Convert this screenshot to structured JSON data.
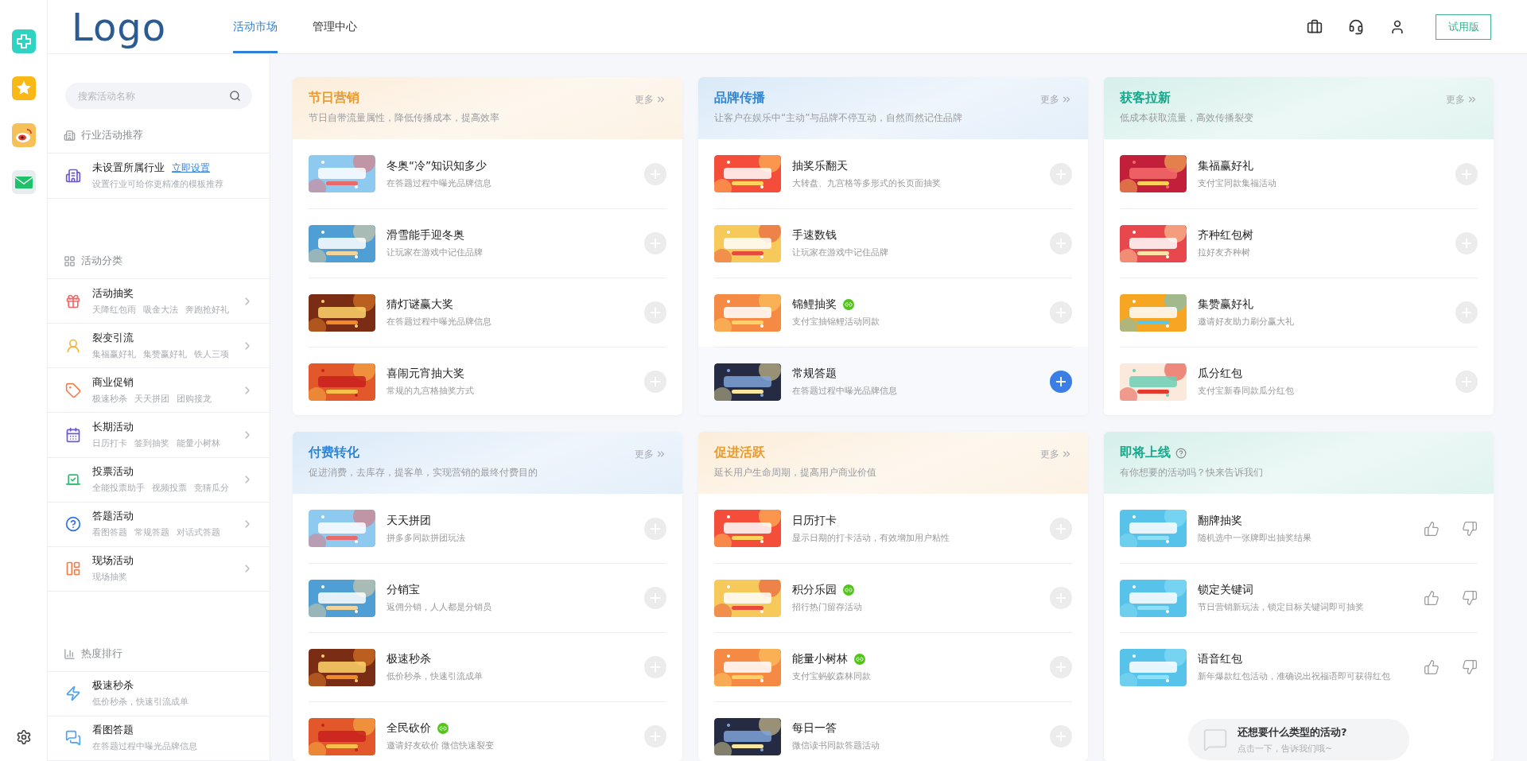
{
  "topbar": {
    "logo": "Logo",
    "tabs": [
      {
        "label": "活动市场",
        "selected": true
      },
      {
        "label": "管理中心",
        "selected": false
      }
    ],
    "trial_button": "试用版"
  },
  "sidebar": {
    "search": {
      "placeholder": "搜索活动名称"
    },
    "industry": {
      "title": "行业活动推荐",
      "name": "未设置所属行业",
      "link": "立即设置",
      "desc": "设置行业可给你更精准的模板推荐"
    },
    "categories": {
      "title": "活动分类",
      "items": [
        {
          "name": "活动抽奖",
          "tags": [
            "天降红包雨",
            "吸金大法",
            "奔跑抢好礼"
          ],
          "color": "#f2676a"
        },
        {
          "name": "裂变引流",
          "tags": [
            "集福赢好礼",
            "集赞赢好礼",
            "铁人三项"
          ],
          "color": "#f7b23b"
        },
        {
          "name": "商业促销",
          "tags": [
            "极速秒杀",
            "天天拼团",
            "团购接龙"
          ],
          "color": "#f47c4a"
        },
        {
          "name": "长期活动",
          "tags": [
            "日历打卡",
            "签到抽奖",
            "能量小树林"
          ],
          "color": "#6a5acd"
        },
        {
          "name": "投票活动",
          "tags": [
            "全能投票助手",
            "视频投票",
            "竞猜瓜分"
          ],
          "color": "#2fbf71"
        },
        {
          "name": "答题活动",
          "tags": [
            "看图答题",
            "常规答题",
            "对话式答题"
          ],
          "color": "#2f6fe4"
        },
        {
          "name": "现场活动",
          "tags": [
            "现场抽奖"
          ],
          "color": "#f47c4a"
        }
      ]
    },
    "ranking": {
      "title": "热度排行",
      "items": [
        {
          "name": "极速秒杀",
          "desc": "低价秒杀，快速引流成单"
        },
        {
          "name": "看图答题",
          "desc": "在答题过程中曝光品牌信息"
        }
      ]
    }
  },
  "cards": [
    {
      "title": "节日营销",
      "subtitle": "节日自带流量属性，降低传播成本，提高效率",
      "color": "#eb9a2c",
      "more": "更多",
      "items": [
        {
          "kind": "add",
          "title": "冬奥“冷”知识知多少",
          "desc": "在答题过程中曝光品牌信息",
          "badge": false,
          "selected": false
        },
        {
          "kind": "add",
          "title": "滑雪能手迎冬奥",
          "desc": "让玩家在游戏中记住品牌",
          "badge": false,
          "selected": false
        },
        {
          "kind": "add",
          "title": "猜灯谜赢大奖",
          "desc": "在答题过程中曝光品牌信息",
          "badge": false,
          "selected": false
        },
        {
          "kind": "add",
          "title": "喜闹元宵抽大奖",
          "desc": "常规的九宫格抽奖方式",
          "badge": false,
          "selected": false
        }
      ]
    },
    {
      "title": "品牌传播",
      "subtitle": "让客户在娱乐中“主动”与品牌不停互动，自然而然记住品牌",
      "color": "#2f86d8",
      "more": "更多",
      "items": [
        {
          "kind": "add",
          "title": "抽奖乐翻天",
          "desc": "大转盘、九宫格等多形式的长页面抽奖",
          "badge": false,
          "selected": false
        },
        {
          "kind": "add",
          "title": "手速数钱",
          "desc": "让玩家在游戏中记住品牌",
          "badge": false,
          "selected": false
        },
        {
          "kind": "add",
          "title": "锦鲤抽奖",
          "desc": "支付宝抽锦鲤活动同款",
          "badge": true,
          "selected": false
        },
        {
          "kind": "add",
          "title": "常规答题",
          "desc": "在答题过程中曝光品牌信息",
          "badge": false,
          "selected": true
        }
      ]
    },
    {
      "title": "获客拉新",
      "subtitle": "低成本获取流量，高效传播裂变",
      "color": "#17a88b",
      "more": "更多",
      "items": [
        {
          "kind": "add",
          "title": "集福赢好礼",
          "desc": "支付宝同款集福活动",
          "badge": false,
          "selected": false
        },
        {
          "kind": "add",
          "title": "齐种红包树",
          "desc": "拉好友齐种树",
          "badge": false,
          "selected": false
        },
        {
          "kind": "add",
          "title": "集赞赢好礼",
          "desc": "邀请好友助力刷分赢大礼",
          "badge": false,
          "selected": false
        },
        {
          "kind": "add",
          "title": "瓜分红包",
          "desc": "支付宝新春同款瓜分红包",
          "badge": false,
          "selected": false
        }
      ]
    },
    {
      "title": "付费转化",
      "subtitle": "促进消费，去库存，提客单，实现营销的最终付费目的",
      "color": "#2f86d8",
      "more": "更多",
      "items": [
        {
          "kind": "add",
          "title": "天天拼团",
          "desc": "拼多多同款拼团玩法",
          "badge": false,
          "selected": false
        },
        {
          "kind": "add",
          "title": "分销宝",
          "desc": "返佣分销，人人都是分销员",
          "badge": false,
          "selected": false
        },
        {
          "kind": "add",
          "title": "极速秒杀",
          "desc": "低价秒杀，快速引流成单",
          "badge": false,
          "selected": false
        },
        {
          "kind": "add",
          "title": "全民砍价",
          "desc": "邀请好友砍价 微信快速裂变",
          "badge": true,
          "selected": false
        }
      ]
    },
    {
      "title": "促进活跃",
      "subtitle": "延长用户生命周期，提高用户商业价值",
      "color": "#eb9a2c",
      "more": "更多",
      "items": [
        {
          "kind": "add",
          "title": "日历打卡",
          "desc": "显示日期的打卡活动，有效增加用户粘性",
          "badge": false,
          "selected": false
        },
        {
          "kind": "add",
          "title": "积分乐园",
          "desc": "招行热门留存活动",
          "badge": true,
          "selected": false
        },
        {
          "kind": "add",
          "title": "能量小树林",
          "desc": "支付宝蚂蚁森林同款",
          "badge": true,
          "selected": false
        },
        {
          "kind": "add",
          "title": "每日一答",
          "desc": "微信读书同款答题活动",
          "badge": false,
          "selected": false
        }
      ]
    },
    {
      "title": "即将上线",
      "subtitle": "有你想要的活动吗？快来告诉我们",
      "color": "#17a88b",
      "help": true,
      "items": [
        {
          "kind": "vote",
          "title": "翻牌抽奖",
          "desc": "随机选中一张牌即出抽奖结果",
          "badge": false,
          "selected": false
        },
        {
          "kind": "vote",
          "title": "锁定关键词",
          "desc": "节日营销新玩法，锁定目标关键词即可抽奖",
          "badge": false,
          "selected": false
        },
        {
          "kind": "vote",
          "title": "语音红包",
          "desc": "新年爆款红包活动，准确说出祝福语即可获得红包",
          "badge": false,
          "selected": false
        }
      ],
      "feedback": {
        "title": "还想要什么类型的活动?",
        "subtitle": "点击一下，告诉我们哦~"
      }
    }
  ]
}
